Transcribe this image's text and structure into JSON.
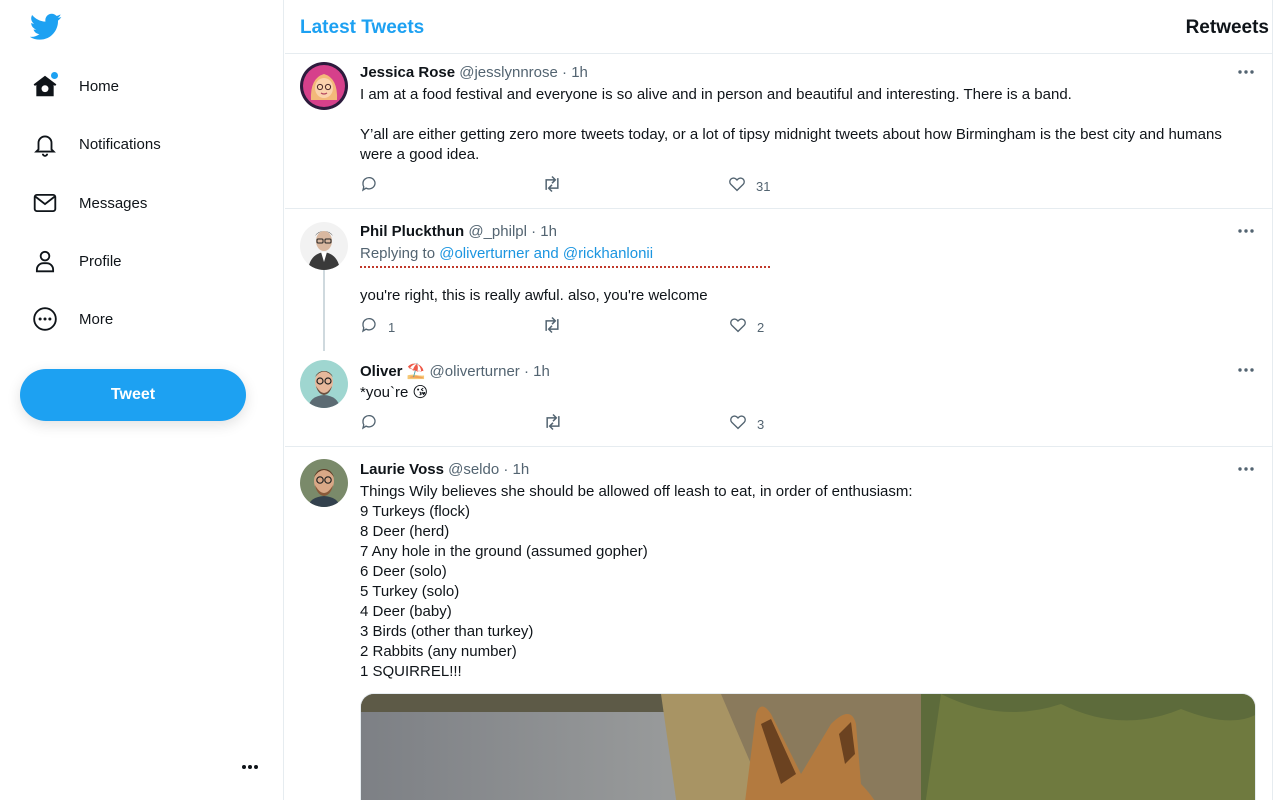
{
  "nav": {
    "items": [
      {
        "label": "Home",
        "icon": "home-icon"
      },
      {
        "label": "Notifications",
        "icon": "bell-icon"
      },
      {
        "label": "Messages",
        "icon": "envelope-icon"
      },
      {
        "label": "Profile",
        "icon": "person-icon"
      },
      {
        "label": "More",
        "icon": "more-circle-icon"
      }
    ],
    "tweet_button": "Tweet"
  },
  "header": {
    "title": "Latest Tweets",
    "right_label": "Retweets"
  },
  "tweets": [
    {
      "name": "Jessica Rose",
      "handle": "@jesslynnrose",
      "sep": "·",
      "time": "1h",
      "text": "I am at a food festival and everyone is so alive and in person and beautiful and interesting. There is a band.\n\nY’all are either getting zero more tweets today, or a lot of tipsy midnight tweets about how Birmingham is the best city and humans were a good idea.",
      "replies": "",
      "retweets": "",
      "likes": "31"
    },
    {
      "name": "Phil Pluckthun",
      "handle": "@_philpl",
      "sep": "·",
      "time": "1h",
      "replying_prefix": "Replying to",
      "replying_mentions": "@oliverturner and @rickhanlonii",
      "text": "you're right, this is really awful. also, you're welcome",
      "replies": "1",
      "retweets": "",
      "likes": "2"
    },
    {
      "name": "Oliver ⛱️",
      "handle": "@oliverturner",
      "sep": "·",
      "time": "1h",
      "text": "*you`re 😘",
      "replies": "",
      "retweets": "",
      "likes": "3"
    },
    {
      "name": "Laurie Voss",
      "handle": "@seldo",
      "sep": "·",
      "time": "1h",
      "text": "Things Wily believes she should be allowed off leash to eat, in order of enthusiasm:\n9 Turkeys (flock)\n8 Deer (herd)\n7 Any hole in the ground (assumed gopher)\n6 Deer (solo)\n5 Turkey (solo)\n4 Deer (baby)\n3 Birds (other than turkey)\n2 Rabbits (any number)\n1 SQUIRREL!!!"
    }
  ],
  "colors": {
    "accent": "#1da1f2",
    "text": "#0f1419",
    "muted": "#536471",
    "border": "#e6ecf0"
  }
}
